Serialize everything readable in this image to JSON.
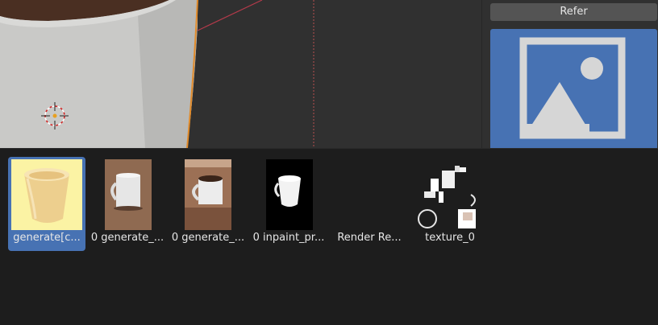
{
  "side_panel": {
    "refer_label": "Refer",
    "image_icon": "image-placeholder-icon"
  },
  "viewport": {
    "cursor_icon": "3d-cursor-icon"
  },
  "browser": {
    "items": [
      {
        "label": "generate[c...",
        "icon": "cup-thumbnail",
        "selected": true
      },
      {
        "label": "0 generate_...",
        "icon": "mug-thumbnail",
        "selected": false
      },
      {
        "label": "0 generate_...",
        "icon": "mug-coffee-thumbnail",
        "selected": false
      },
      {
        "label": "0 inpaint_pr...",
        "icon": "inpaint-mask-thumbnail",
        "selected": false
      },
      {
        "label": "Render Re...",
        "icon": "render-result-thumbnail",
        "selected": false
      },
      {
        "label": "texture_0",
        "icon": "texture-thumbnail",
        "selected": false
      }
    ]
  },
  "colors": {
    "accent": "#4772b3",
    "background": "#1d1d1d",
    "viewport": "#303030"
  }
}
